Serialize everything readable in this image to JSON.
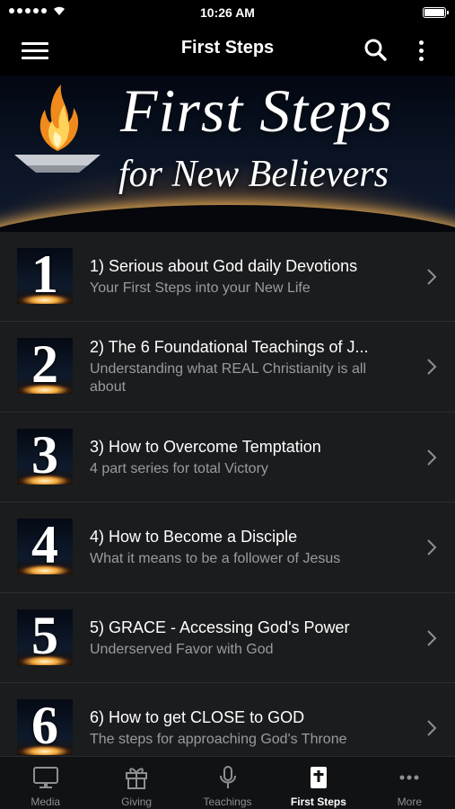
{
  "status_bar": {
    "time": "10:26 AM"
  },
  "nav": {
    "title": "First Steps"
  },
  "banner": {
    "title": "First Steps",
    "subtitle": "for New Believers"
  },
  "items": [
    {
      "num": "1",
      "title": "1) Serious about God daily Devotions",
      "subtitle": "Your First Steps into your New Life"
    },
    {
      "num": "2",
      "title": "2) The 6 Foundational Teachings of J...",
      "subtitle": "Understanding what REAL Christianity is all about"
    },
    {
      "num": "3",
      "title": "3) How to Overcome Temptation",
      "subtitle": "4 part series for total Victory"
    },
    {
      "num": "4",
      "title": "4) How to Become a Disciple",
      "subtitle": "What it means to be a follower of Jesus"
    },
    {
      "num": "5",
      "title": "5) GRACE - Accessing God's Power",
      "subtitle": "Underserved Favor with God"
    },
    {
      "num": "6",
      "title": "6) How to get CLOSE to GOD",
      "subtitle": "The steps for approaching God's Throne"
    }
  ],
  "tabs": [
    {
      "label": "Media",
      "icon": "tv-icon"
    },
    {
      "label": "Giving",
      "icon": "gift-icon"
    },
    {
      "label": "Teachings",
      "icon": "microphone-icon"
    },
    {
      "label": "First Steps",
      "icon": "bible-icon",
      "active": true
    },
    {
      "label": "More",
      "icon": "more-dots-icon"
    }
  ],
  "colors": {
    "background": "#1b1c1e",
    "bar": "#000000",
    "active_tab": "#ffffff",
    "inactive_tab": "#8e8f93",
    "subtitle": "#9a9ba0"
  }
}
